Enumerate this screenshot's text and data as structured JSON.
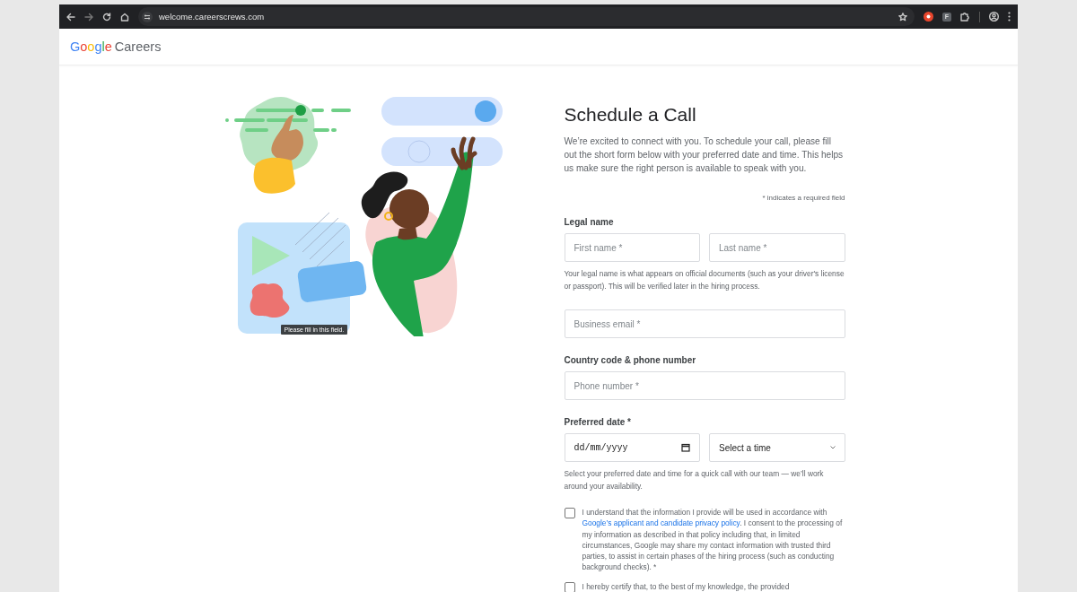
{
  "browser": {
    "url": "welcome.careerscrews.com",
    "extension_label": "F"
  },
  "header": {
    "logo_brand": "Google",
    "logo_product": "Careers"
  },
  "illustration": {
    "tooltip": "Please fill in this field."
  },
  "form": {
    "title": "Schedule a Call",
    "intro": "We’re excited to connect with you. To schedule your call, please fill out the short form below with your preferred date and time. This helps us make sure the right person is available to speak with you.",
    "required_note": "* indicates a required field",
    "sections": [
      {
        "kind": "pair",
        "label": "Legal name",
        "fields": [
          {
            "placeholder": "First name *"
          },
          {
            "placeholder": "Last name *"
          }
        ],
        "hint": "Your legal name is what appears on official documents (such as your driver's license or passport). This will be verified later in the hiring process."
      },
      {
        "kind": "single",
        "fields": [
          {
            "placeholder": "Business email *"
          }
        ]
      },
      {
        "kind": "single",
        "label": "Country code & phone number",
        "fields": [
          {
            "placeholder": "Phone number *"
          }
        ]
      },
      {
        "kind": "datetime",
        "label": "Preferred date *",
        "date_placeholder": "dd/mm/yyyy",
        "time_select": "Select a time",
        "hint": "Select your preferred date and time for a quick call with our team — we’ll work around your availability."
      }
    ],
    "consents": [
      {
        "text": "I understand that the information I provide will be used in accordance with ",
        "link": "Google’s applicant and candidate privacy policy",
        "text_after": ". I consent to the processing of my information as described in that policy including that, in limited circumstances, Google may share my contact information with trusted third parties, to assist in certain phases of the hiring process (such as conducting background checks). *",
        "checked": false
      },
      {
        "text": "I hereby certify that, to the best of my knowledge, the provided",
        "checked": false
      }
    ]
  }
}
